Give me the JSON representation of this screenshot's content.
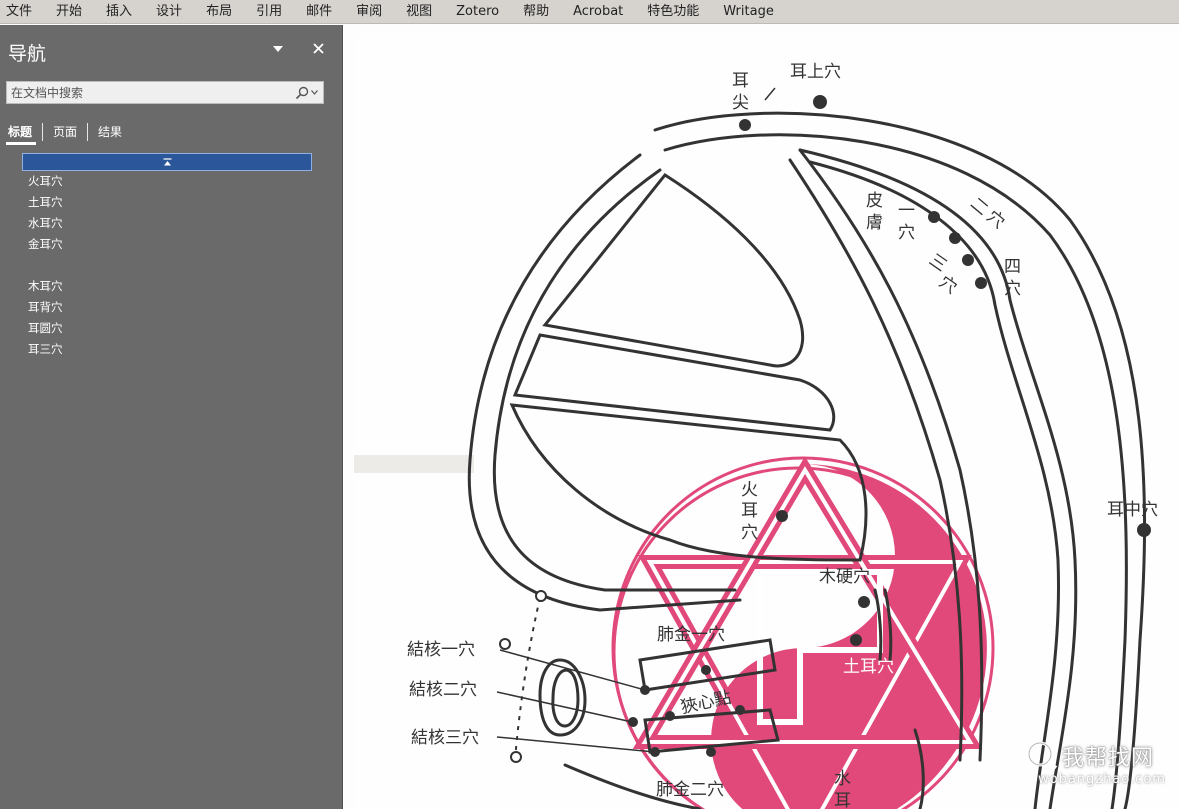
{
  "menubar": {
    "items": [
      "文件",
      "开始",
      "插入",
      "设计",
      "布局",
      "引用",
      "邮件",
      "审阅",
      "视图",
      "Zotero",
      "帮助",
      "Acrobat",
      "特色功能",
      "Writage"
    ]
  },
  "nav_pane": {
    "title": "导航",
    "search_placeholder": "在文档中搜索",
    "tabs": [
      "标题",
      "页面",
      "结果"
    ],
    "headings": [
      "火耳穴",
      "土耳穴",
      "水耳穴",
      "金耳穴",
      "",
      "木耳穴",
      "耳背穴",
      "耳圆穴",
      "耳三穴"
    ]
  },
  "diagram": {
    "labels": {
      "ear_tip_1": "耳",
      "ear_tip_2": "尖",
      "ear_upper": "耳上穴",
      "skin_1": "皮",
      "skin_2": "膚",
      "one_1": "一",
      "one_2": "穴",
      "two_1": "二",
      "two_2": "穴",
      "three_1": "三",
      "three_2": "穴",
      "four_1": "四",
      "four_2": "穴",
      "ear_middle": "耳中穴",
      "fire_1": "火",
      "fire_2": "耳",
      "fire_3": "穴",
      "wood_hard": "木硬穴",
      "lung_metal_1": "肺金一穴",
      "earth": "土耳穴",
      "angina": "狹心點",
      "tb_1": "結核一穴",
      "tb_2": "結核二穴",
      "tb_3": "結核三穴",
      "lung_metal_2": "肺金二穴",
      "water_1": "水",
      "water_2": "耳"
    },
    "colors": {
      "line": "#333333",
      "pink": "#e0497a",
      "paper": "#fdfdfd"
    }
  },
  "watermark": {
    "text": "我帮找网",
    "url": "wobangzhao.com"
  }
}
